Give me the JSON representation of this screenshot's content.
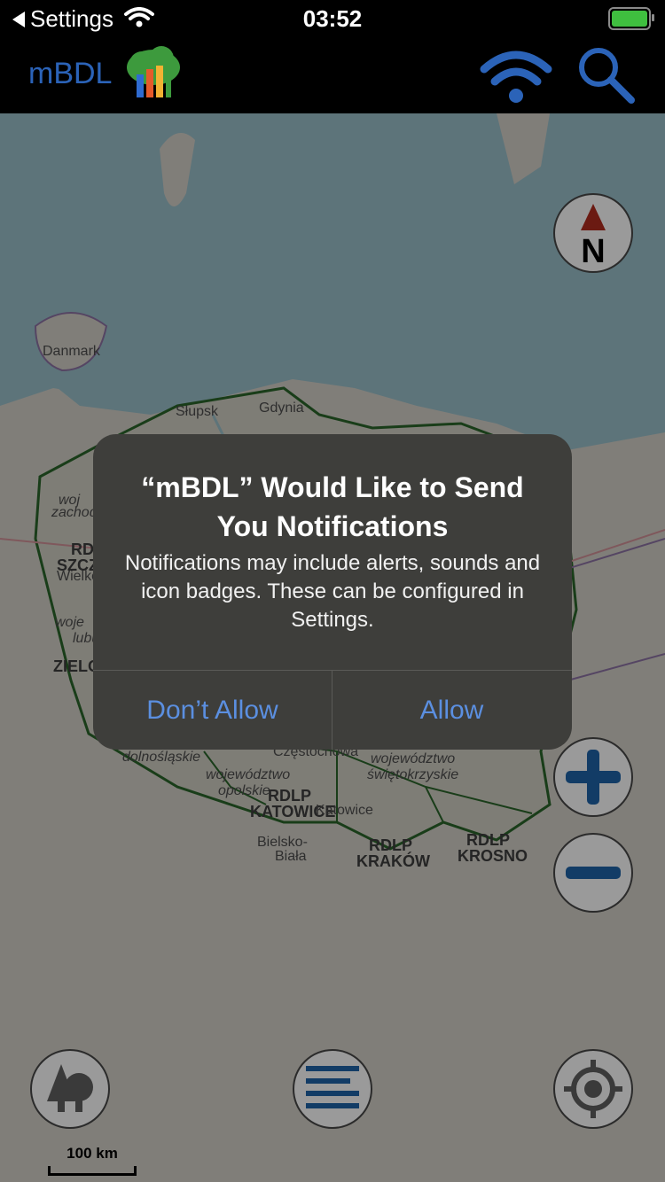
{
  "status_bar": {
    "back_label": "Settings",
    "time": "03:52"
  },
  "app": {
    "title": "mBDL",
    "brand_color": "#2b63b8"
  },
  "map": {
    "labels": [
      "Danmark",
      "Słupsk",
      "Gdynia",
      "woj",
      "zachod",
      "RDL",
      "SZCZ",
      "Wielko",
      "woje",
      "lubu",
      "ZIELO",
      "dolnośląskie",
      "Częstochowa",
      "województwo",
      "opolskie",
      "RDLP",
      "KATOWICE",
      "Katowice",
      "Bielsko-",
      "Biała",
      "RDLP",
      "KRAKÓW",
      "województwo",
      "świętokrzyskie",
      "RDLP",
      "KROSNO"
    ],
    "scale_label": "100 km",
    "compass_label": "N"
  },
  "dialog": {
    "title": "“mBDL” Would Like to Send You Notifications",
    "message": "Notifications may include alerts, sounds and icon badges. These can be configured in Settings.",
    "deny_label": "Don’t Allow",
    "allow_label": "Allow",
    "accent_color": "#5b8fe0"
  },
  "icons": {
    "compass": "compass-icon",
    "zoom_in": "plus-icon",
    "zoom_out": "minus-icon",
    "layers": "trees-icon",
    "menu": "list-icon",
    "locate": "target-icon",
    "connection": "wifi-icon",
    "search": "search-icon"
  }
}
